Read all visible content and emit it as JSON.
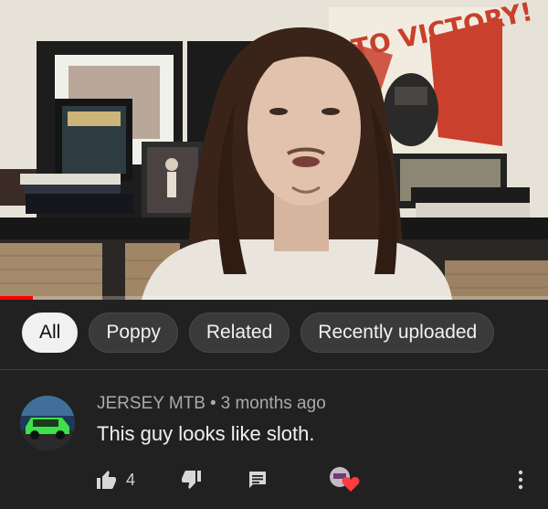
{
  "video": {
    "progress_fraction": 0.06,
    "poster_text": "TO VICTORY!"
  },
  "chips": [
    {
      "label": "All",
      "active": true
    },
    {
      "label": "Poppy",
      "active": false
    },
    {
      "label": "Related",
      "active": false
    },
    {
      "label": "Recently uploaded",
      "active": false
    }
  ],
  "comment": {
    "author": "JERSEY MTB",
    "separator": "•",
    "time": "3 months ago",
    "text": "This guy looks like sloth.",
    "like_count": "4"
  },
  "icons": {
    "like": "thumbs-up-icon",
    "dislike": "thumbs-down-icon",
    "reply": "reply-icon",
    "creator_heart": "creator-heart-icon",
    "more": "more-vert-icon"
  },
  "colors": {
    "background": "#212121",
    "chip_active_bg": "#f1f1f1",
    "progress": "#ff0000",
    "heart": "#ff3b3b"
  }
}
